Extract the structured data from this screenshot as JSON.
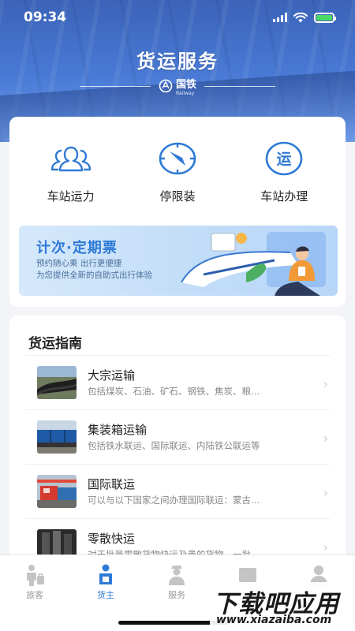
{
  "status_bar": {
    "time": "09:34"
  },
  "header": {
    "title": "货运服务",
    "brand": "国铁",
    "brand_sub": "Railway"
  },
  "services": [
    {
      "label": "车站运力",
      "icon": "people-icon"
    },
    {
      "label": "停限装",
      "icon": "compass-icon"
    },
    {
      "label": "车站办理",
      "icon": "yun-badge-icon",
      "glyph": "运"
    }
  ],
  "banner": {
    "title": "计次·定期票",
    "line1": "预约随心乘  出行更便捷",
    "line2": "为您提供全新的自助式出行体验"
  },
  "guide": {
    "title": "货运指南",
    "items": [
      {
        "name": "大宗运输",
        "desc": "包括煤炭、石油、矿石、钢铁、焦炭、粮…"
      },
      {
        "name": "集装箱运输",
        "desc": "包括铁水联运、国际联运、内陆铁公联运等"
      },
      {
        "name": "国际联运",
        "desc": "可以与以下国家之间办理国际联运：蒙古…"
      },
      {
        "name": "零散快运",
        "desc": "对于批量零散货物快运及贵的货物，一批…"
      }
    ]
  },
  "tabs": [
    {
      "label": "旅客",
      "icon": "traveler-icon"
    },
    {
      "label": "货主",
      "icon": "cargo-owner-icon",
      "active": true
    },
    {
      "label": "服务",
      "icon": "service-person-icon"
    },
    {
      "label": "",
      "icon": "message-icon"
    },
    {
      "label": "",
      "icon": "profile-icon"
    }
  ],
  "watermark": {
    "main": "下载吧应用",
    "sub": "www.xiazaiba.com"
  },
  "colors": {
    "primary": "#2f7ad6",
    "hero": "#4a7bd6"
  }
}
